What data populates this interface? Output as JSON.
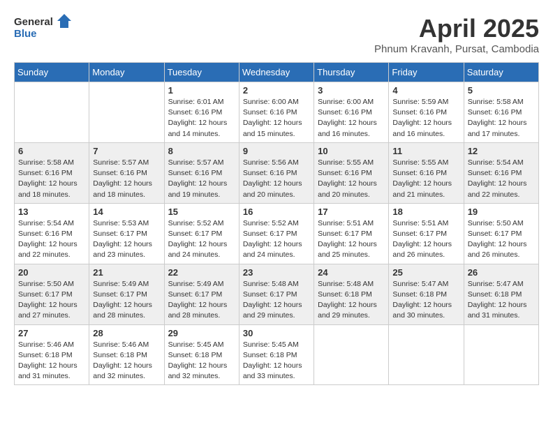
{
  "header": {
    "logo_general": "General",
    "logo_blue": "Blue",
    "title": "April 2025",
    "subtitle": "Phnum Kravanh, Pursat, Cambodia"
  },
  "weekdays": [
    "Sunday",
    "Monday",
    "Tuesday",
    "Wednesday",
    "Thursday",
    "Friday",
    "Saturday"
  ],
  "weeks": [
    [
      {
        "day": "",
        "info": ""
      },
      {
        "day": "",
        "info": ""
      },
      {
        "day": "1",
        "info": "Sunrise: 6:01 AM\nSunset: 6:16 PM\nDaylight: 12 hours and 14 minutes."
      },
      {
        "day": "2",
        "info": "Sunrise: 6:00 AM\nSunset: 6:16 PM\nDaylight: 12 hours and 15 minutes."
      },
      {
        "day": "3",
        "info": "Sunrise: 6:00 AM\nSunset: 6:16 PM\nDaylight: 12 hours and 16 minutes."
      },
      {
        "day": "4",
        "info": "Sunrise: 5:59 AM\nSunset: 6:16 PM\nDaylight: 12 hours and 16 minutes."
      },
      {
        "day": "5",
        "info": "Sunrise: 5:58 AM\nSunset: 6:16 PM\nDaylight: 12 hours and 17 minutes."
      }
    ],
    [
      {
        "day": "6",
        "info": "Sunrise: 5:58 AM\nSunset: 6:16 PM\nDaylight: 12 hours and 18 minutes."
      },
      {
        "day": "7",
        "info": "Sunrise: 5:57 AM\nSunset: 6:16 PM\nDaylight: 12 hours and 18 minutes."
      },
      {
        "day": "8",
        "info": "Sunrise: 5:57 AM\nSunset: 6:16 PM\nDaylight: 12 hours and 19 minutes."
      },
      {
        "day": "9",
        "info": "Sunrise: 5:56 AM\nSunset: 6:16 PM\nDaylight: 12 hours and 20 minutes."
      },
      {
        "day": "10",
        "info": "Sunrise: 5:55 AM\nSunset: 6:16 PM\nDaylight: 12 hours and 20 minutes."
      },
      {
        "day": "11",
        "info": "Sunrise: 5:55 AM\nSunset: 6:16 PM\nDaylight: 12 hours and 21 minutes."
      },
      {
        "day": "12",
        "info": "Sunrise: 5:54 AM\nSunset: 6:16 PM\nDaylight: 12 hours and 22 minutes."
      }
    ],
    [
      {
        "day": "13",
        "info": "Sunrise: 5:54 AM\nSunset: 6:16 PM\nDaylight: 12 hours and 22 minutes."
      },
      {
        "day": "14",
        "info": "Sunrise: 5:53 AM\nSunset: 6:17 PM\nDaylight: 12 hours and 23 minutes."
      },
      {
        "day": "15",
        "info": "Sunrise: 5:52 AM\nSunset: 6:17 PM\nDaylight: 12 hours and 24 minutes."
      },
      {
        "day": "16",
        "info": "Sunrise: 5:52 AM\nSunset: 6:17 PM\nDaylight: 12 hours and 24 minutes."
      },
      {
        "day": "17",
        "info": "Sunrise: 5:51 AM\nSunset: 6:17 PM\nDaylight: 12 hours and 25 minutes."
      },
      {
        "day": "18",
        "info": "Sunrise: 5:51 AM\nSunset: 6:17 PM\nDaylight: 12 hours and 26 minutes."
      },
      {
        "day": "19",
        "info": "Sunrise: 5:50 AM\nSunset: 6:17 PM\nDaylight: 12 hours and 26 minutes."
      }
    ],
    [
      {
        "day": "20",
        "info": "Sunrise: 5:50 AM\nSunset: 6:17 PM\nDaylight: 12 hours and 27 minutes."
      },
      {
        "day": "21",
        "info": "Sunrise: 5:49 AM\nSunset: 6:17 PM\nDaylight: 12 hours and 28 minutes."
      },
      {
        "day": "22",
        "info": "Sunrise: 5:49 AM\nSunset: 6:17 PM\nDaylight: 12 hours and 28 minutes."
      },
      {
        "day": "23",
        "info": "Sunrise: 5:48 AM\nSunset: 6:17 PM\nDaylight: 12 hours and 29 minutes."
      },
      {
        "day": "24",
        "info": "Sunrise: 5:48 AM\nSunset: 6:18 PM\nDaylight: 12 hours and 29 minutes."
      },
      {
        "day": "25",
        "info": "Sunrise: 5:47 AM\nSunset: 6:18 PM\nDaylight: 12 hours and 30 minutes."
      },
      {
        "day": "26",
        "info": "Sunrise: 5:47 AM\nSunset: 6:18 PM\nDaylight: 12 hours and 31 minutes."
      }
    ],
    [
      {
        "day": "27",
        "info": "Sunrise: 5:46 AM\nSunset: 6:18 PM\nDaylight: 12 hours and 31 minutes."
      },
      {
        "day": "28",
        "info": "Sunrise: 5:46 AM\nSunset: 6:18 PM\nDaylight: 12 hours and 32 minutes."
      },
      {
        "day": "29",
        "info": "Sunrise: 5:45 AM\nSunset: 6:18 PM\nDaylight: 12 hours and 32 minutes."
      },
      {
        "day": "30",
        "info": "Sunrise: 5:45 AM\nSunset: 6:18 PM\nDaylight: 12 hours and 33 minutes."
      },
      {
        "day": "",
        "info": ""
      },
      {
        "day": "",
        "info": ""
      },
      {
        "day": "",
        "info": ""
      }
    ]
  ]
}
